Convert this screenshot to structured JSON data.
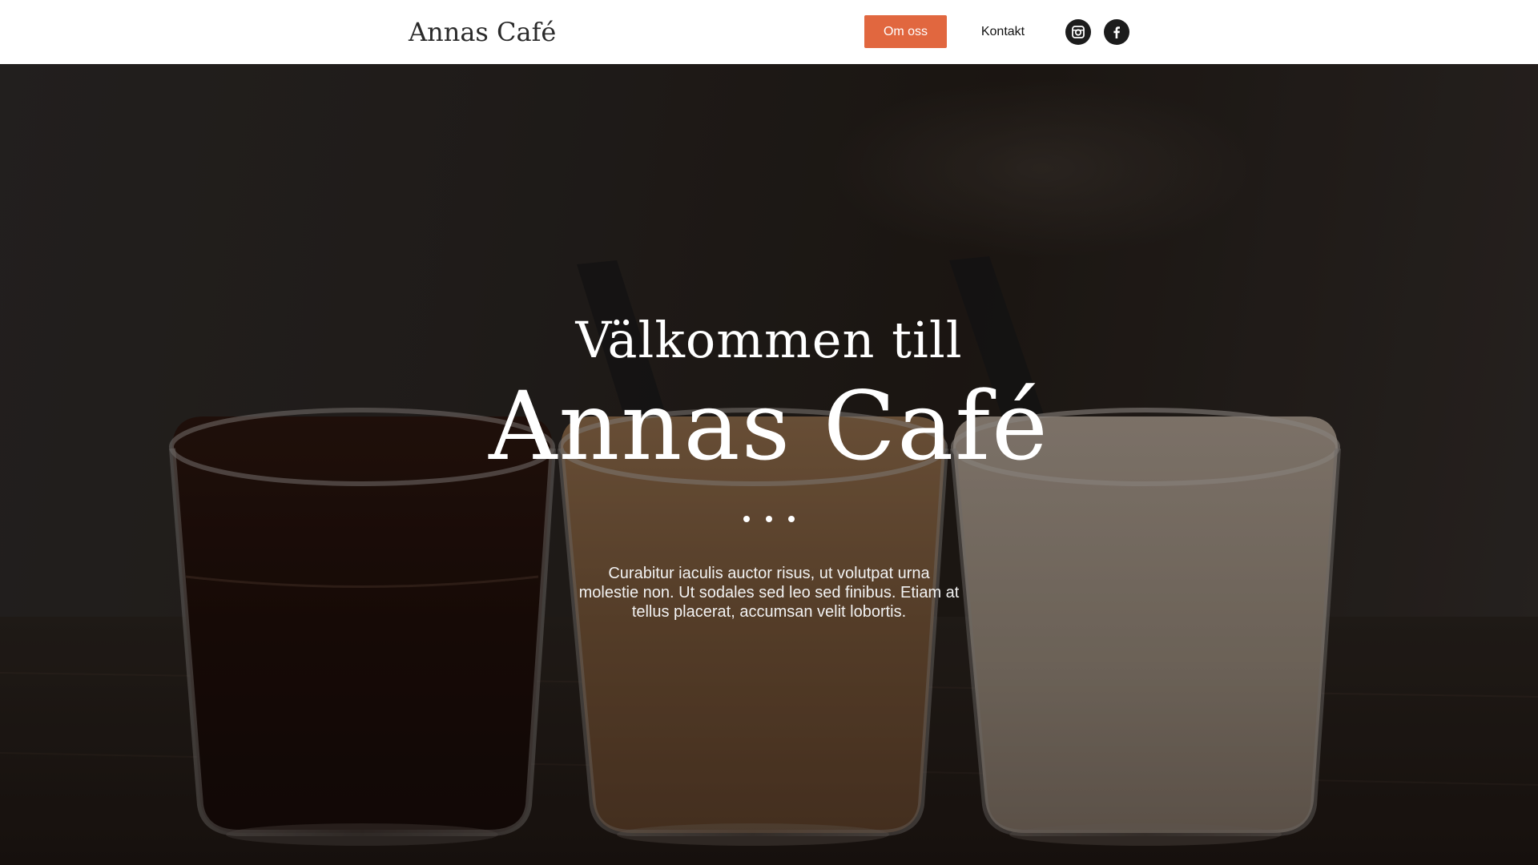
{
  "header": {
    "brand": "Annas Café",
    "nav": {
      "about_label": "Om oss",
      "contact_label": "Kontakt"
    },
    "social": [
      "instagram-icon",
      "facebook-icon"
    ],
    "accent_color": "#e1673f"
  },
  "hero": {
    "subtitle": "Välkommen till",
    "title": "Annas Café",
    "text": "Curabitur iaculis auctor risus, ut volutpat urna molestie non. Ut sodales sed leo sed finibus. Etiam at tellus placerat, accumsan velit lobortis.",
    "background_image": "three glasses of coffee with spoons on a wooden table"
  }
}
